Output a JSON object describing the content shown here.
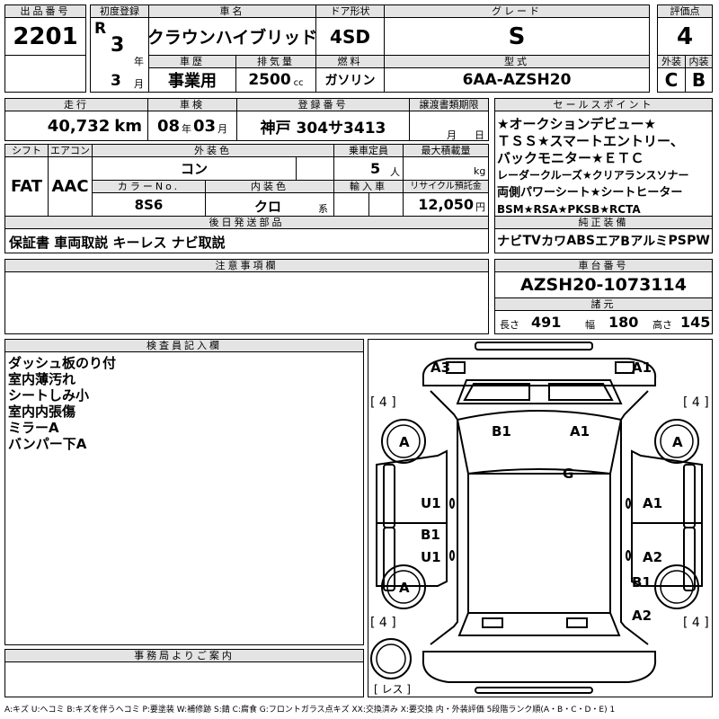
{
  "headers": {
    "lot": "出品番号",
    "first_reg": "初度登録",
    "car_name": "車名",
    "door": "ドア形状",
    "grade": "グレード",
    "score": "評価点",
    "history": "車歴",
    "displacement": "排気量",
    "fuel": "燃料",
    "model": "型式",
    "exterior": "外装",
    "interior": "内装",
    "mileage": "走行",
    "inspection": "車検",
    "registration": "登録番号",
    "transfer": "譲渡書類期限",
    "sales_point": "セールスポイント",
    "shift": "シフト",
    "aircon": "エアコン",
    "ext_color": "外装色",
    "capacity": "乗車定員",
    "max_load": "最大積載量",
    "color_no": "カラーNo.",
    "int_color": "内装色",
    "import": "輸入車",
    "recycle": "リサイクル預託金",
    "later_parts": "後日発送部品",
    "genuine": "純正装備",
    "caution": "注意事項欄",
    "chassis": "車台番号",
    "specs": "諸元",
    "inspector": "検査員記入欄",
    "office": "事務局よりご案内"
  },
  "lot_no": "2201",
  "era": "R",
  "year": "3",
  "year_unit": "年",
  "month": "3",
  "month_unit": "月",
  "car_name": "クラウンハイブリッド",
  "door_type": "4SD",
  "grade": "S",
  "score": "4",
  "history": "事業用",
  "displacement": "2500",
  "displacement_unit": "cc",
  "fuel": "ガソリン",
  "model": "6AA-AZSH20",
  "exterior_grade": "C",
  "interior_grade": "B",
  "mileage": "40,732",
  "mileage_unit": "km",
  "inspection_year": "08",
  "inspection_year_unit": "年",
  "inspection_month": "03",
  "inspection_month_unit": "月",
  "registration": "神戸 304サ3413",
  "transfer_month_unit": "月",
  "transfer_day_unit": "日",
  "sales_points": [
    "★オークションデビュー★",
    "ＴＳＳ★スマートエントリー、",
    "バックモニター★ＥＴＣ",
    "レーダークルーズ★クリアランスソナー",
    "両側パワーシート★シートヒーター",
    "BSM★RSA★PKSB★RCTA"
  ],
  "shift": "FAT",
  "aircon": "AAC",
  "ext_color": "コン",
  "capacity": "5",
  "capacity_unit": "人",
  "max_load_unit": "kg",
  "color_no": "8S6",
  "int_color": "クロ",
  "int_color_unit": "系",
  "recycle": "12,050",
  "recycle_unit": "円",
  "later_parts": "保証書 車両取説 キーレス ナビ取説",
  "genuine_items": [
    "ナビ",
    "TV",
    "カワ",
    "ABS",
    "エアB",
    "アルミ",
    "PS",
    "PW"
  ],
  "chassis_no": "AZSH20-1073114",
  "length_label": "長さ",
  "length": "491",
  "width_label": "幅",
  "width": "180",
  "height_label": "高さ",
  "height": "145",
  "inspector_notes": [
    "ダッシュ板のり付",
    "室内薄汚れ",
    "シートしみ小",
    "室内内張傷",
    "ミラーA",
    "バンパー下A"
  ],
  "diagram": {
    "tire_labels": [
      "[ 4 ]",
      "[ 4 ]",
      "[ 4 ]",
      "[ 4 ]"
    ],
    "spare_label": "[ レス ]",
    "marks": {
      "a3_front_left": "A3",
      "a1_front_right": "A1",
      "tire_fl": "A",
      "tire_fr": "A",
      "tire_rl": "A",
      "b1_roof": "B1",
      "a1_roof": "A1",
      "g_roof": "G",
      "u1_left_front": "U1",
      "b1_left_rear": "B1",
      "u1_left_rear": "U1",
      "a1_right_front": "A1",
      "a2_right_rear": "A2",
      "b1_right_rear_tire": "B1",
      "a2_rear_right": "A2"
    }
  },
  "legend": "A:キズ U:ヘコミ B:キズを伴うヘコミ P:要塗装 W:補修跡 S:錆 C:腐食 G:フロントガラス点キズ XX:交換済み X:要交換 内・外装評価 5段階ランク順(A・B・C・D・E) 1"
}
